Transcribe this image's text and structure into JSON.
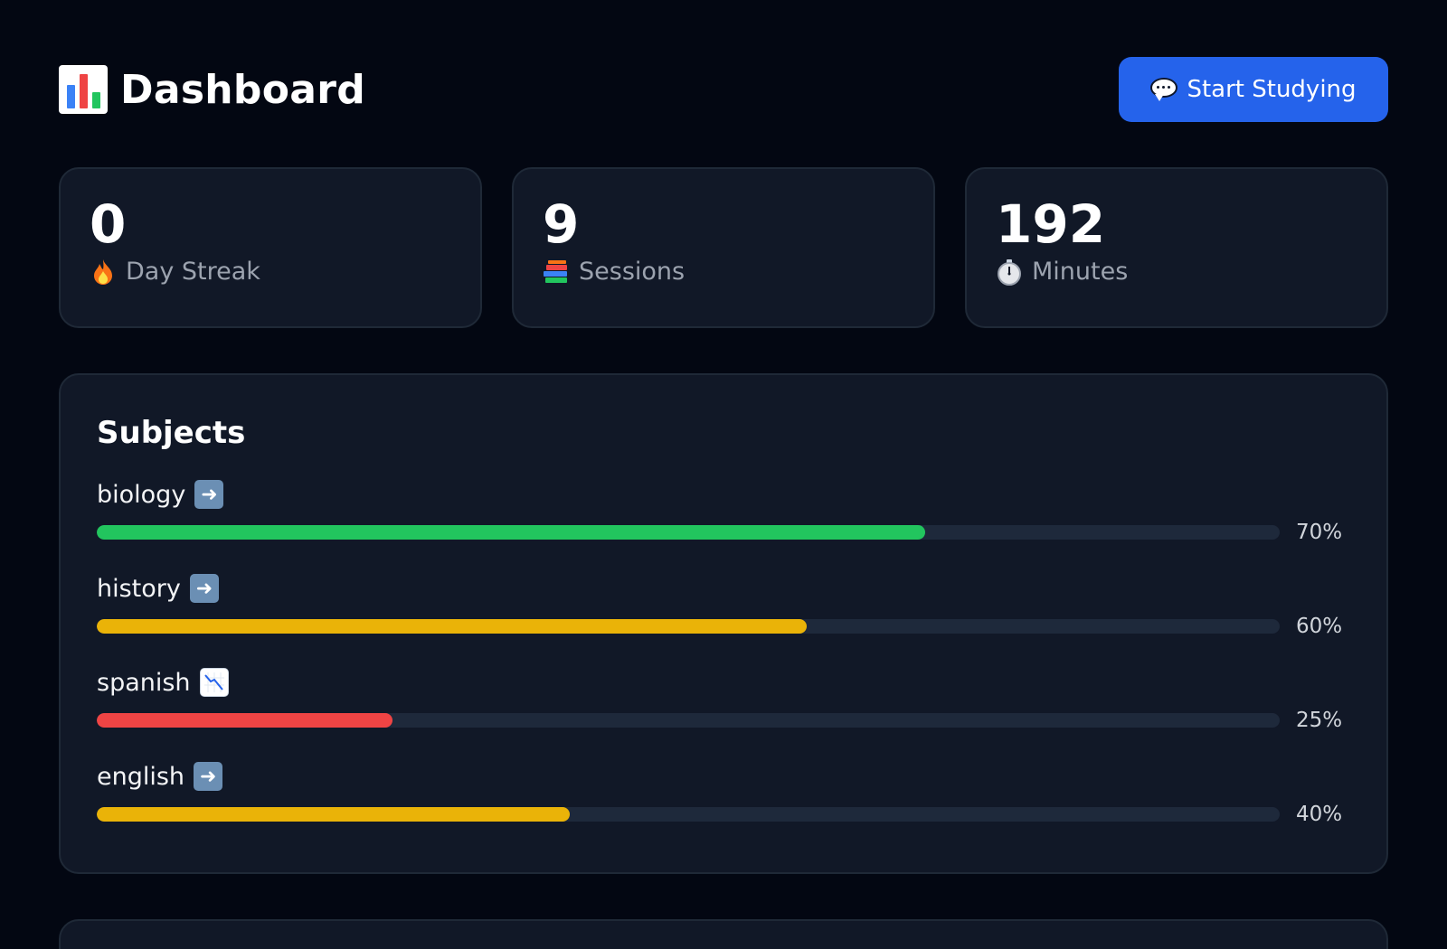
{
  "header": {
    "title": "Dashboard",
    "title_icon": "bar-chart-icon",
    "start_button_label": "Start Studying",
    "start_button_icon": "speech-bubble-icon",
    "accent_color": "#2563eb"
  },
  "stats": [
    {
      "value": "0",
      "label": "Day Streak",
      "icon": "fire-icon"
    },
    {
      "value": "9",
      "label": "Sessions",
      "icon": "books-icon"
    },
    {
      "value": "192",
      "label": "Minutes",
      "icon": "stopwatch-icon"
    }
  ],
  "subjects": {
    "title": "Subjects",
    "items": [
      {
        "name": "biology",
        "trend_icon": "right-arrow-icon",
        "percent_label": "70%",
        "percent": 70,
        "color": "#22c55e"
      },
      {
        "name": "history",
        "trend_icon": "right-arrow-icon",
        "percent_label": "60%",
        "percent": 60,
        "color": "#eab308"
      },
      {
        "name": "spanish",
        "trend_icon": "chart-decreasing-icon",
        "percent_label": "25%",
        "percent": 25,
        "color": "#ef4444"
      },
      {
        "name": "english",
        "trend_icon": "right-arrow-icon",
        "percent_label": "40%",
        "percent": 40,
        "color": "#eab308"
      }
    ]
  }
}
